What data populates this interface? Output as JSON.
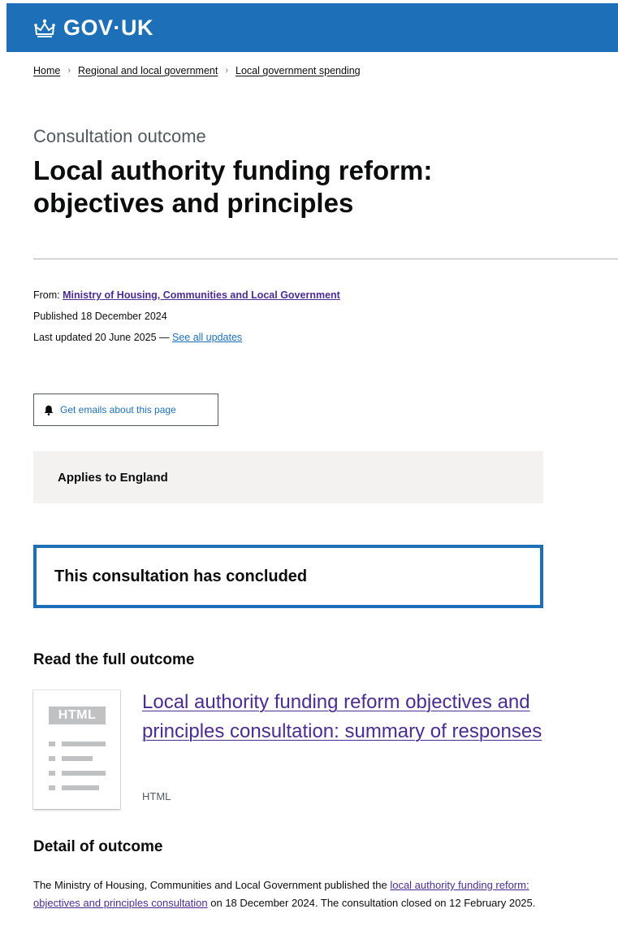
{
  "header": {
    "logo_text": "GOV·UK",
    "logo_icon": "crown-icon",
    "brand_color": "#1d70b8"
  },
  "breadcrumb": [
    {
      "label": "Home"
    },
    {
      "label": "Regional and local government"
    },
    {
      "label": "Local government spending"
    }
  ],
  "page": {
    "caption": "Consultation outcome",
    "title": "Local authority funding reform: objectives and principles"
  },
  "meta": {
    "from_label": "From:",
    "organisation": "Ministry of Housing, Communities and Local Government",
    "published": "Published 18 December 2024",
    "last_updated": "Last updated 20 June 2025 —",
    "see_all_updates": "See all updates"
  },
  "email_button": {
    "label": "Get emails about this page",
    "icon": "bell-icon"
  },
  "applies_to": "Applies to England",
  "notice": "This consultation has concluded",
  "read_outcome": {
    "heading": "Read the full outcome",
    "thumbnail_label": "HTML",
    "attachment_title": "Local authority funding reform objectives and principles consultation: summary of responses",
    "attachment_format": "HTML"
  },
  "detail": {
    "heading": "Detail of outcome",
    "text_before": "The Ministry of Housing, Communities and Local Government published the ",
    "link_text": "local authority funding reform: objectives and principles consultation",
    "text_after": " on 18 December 2024. The consultation closed on 12 February 2025."
  }
}
